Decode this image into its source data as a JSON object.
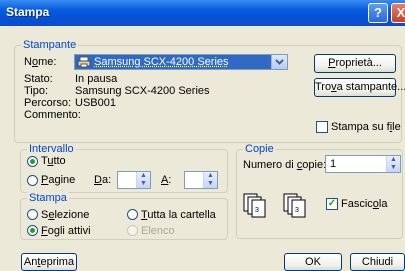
{
  "window": {
    "title": "Stampa",
    "help_label": "?",
    "close_label": "X"
  },
  "printer": {
    "legend": "Stampante",
    "name_label_pre": "N",
    "name_label_u": "o",
    "name_label_post": "me:",
    "selected_printer": "Samsung SCX-4200 Series",
    "properties_pre": "",
    "properties_u": "P",
    "properties_post": "roprietà...",
    "find_pre": "Tro",
    "find_u": "v",
    "find_post": "a stampante...",
    "status_label": "Stato:",
    "status_value": "In pausa",
    "type_label": "Tipo:",
    "type_value": "Samsung SCX-4200 Series",
    "path_label": "Percorso:",
    "path_value": "USB001",
    "comment_label": "Commento:",
    "comment_value": "",
    "print_to_file_pre": "Stampa su f",
    "print_to_file_u": "i",
    "print_to_file_post": "le",
    "print_to_file_checked": false
  },
  "range": {
    "legend": "Intervallo",
    "all_pre": "T",
    "all_u": "u",
    "all_post": "tto",
    "pages_pre": "",
    "pages_u": "P",
    "pages_post": "agine",
    "from_pre": "",
    "from_u": "D",
    "from_post": "a:",
    "to_pre": "",
    "to_u": "A",
    "to_post": ":",
    "from_value": "",
    "to_value": "",
    "selected": "all"
  },
  "copies": {
    "legend": "Copie",
    "count_pre": "Numero di ",
    "count_u": "c",
    "count_post": "opie:",
    "count_value": "1",
    "collate_pre": "Fascic",
    "collate_u": "o",
    "collate_post": "la",
    "collate_checked": true
  },
  "print_what": {
    "legend": "Stampa",
    "selection_pre": "S",
    "selection_u": "e",
    "selection_post": "lezione",
    "workbook_pre": "",
    "workbook_u": "T",
    "workbook_post": "utta la cartella",
    "active_sheets_pre": "",
    "active_sheets_u": "F",
    "active_sheets_post": "ogli attivi",
    "list_label": "Elenco",
    "selected": "active_sheets"
  },
  "buttons": {
    "preview_pre": "An",
    "preview_u": "t",
    "preview_post": "eprima",
    "ok_label": "OK",
    "cancel_label": "Chiudi"
  },
  "colors": {
    "title_gradient_start": "#3a8cf0",
    "title_gradient_end": "#0a4ccf",
    "dialog_background": "#ece9d8",
    "group_legend": "#0046d5",
    "selection_highlight": "#316ac5"
  }
}
